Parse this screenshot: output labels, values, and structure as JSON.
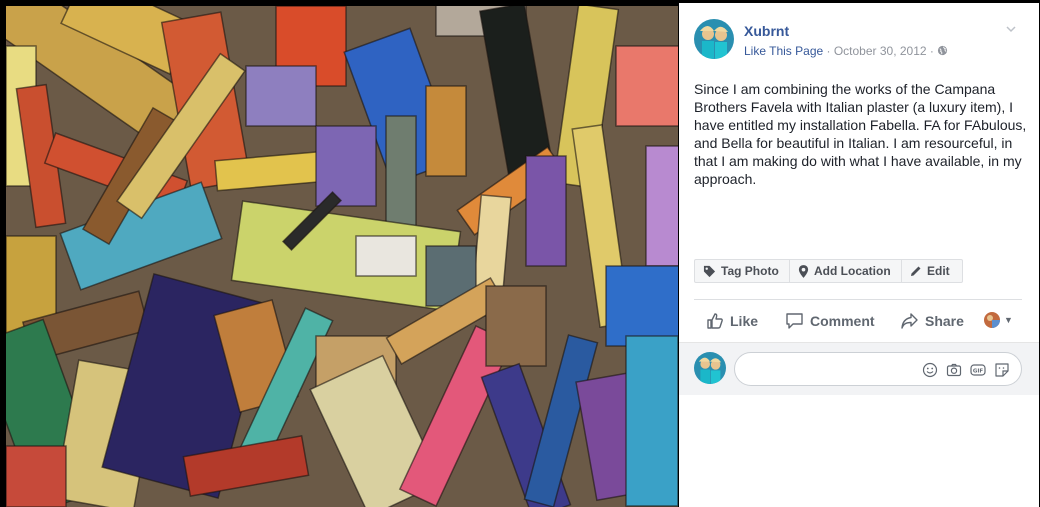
{
  "post": {
    "page_name": "Xubrnt",
    "like_page_link": "Like This Page",
    "date": "October 30, 2012",
    "separator": " · ",
    "caption": "Since I am combining the works of the Campana Brothers Favela with Italian plaster (a luxury item), I have entitled my installation Fabella. FA for FAbulous, and Bella for beautiful in Italian. I am resourceful, in that I am making do with what I have available, in my approach."
  },
  "photo_actions": {
    "tag_photo": "Tag Photo",
    "add_location": "Add Location",
    "edit": "Edit"
  },
  "actions": {
    "like": "Like",
    "comment": "Comment",
    "share": "Share"
  },
  "comment_input": {
    "placeholder": ""
  },
  "icons": {
    "privacy": "globe-icon",
    "options": "chevron-down-icon",
    "tag": "tag-icon",
    "location": "location-pin-icon",
    "edit": "pencil-icon",
    "like": "thumbs-up-icon",
    "comment": "speech-bubble-icon",
    "share": "share-arrow-icon",
    "emoji": "smiley-icon",
    "camera": "camera-icon",
    "gif": "gif-icon",
    "sticker": "sticker-icon"
  },
  "colors": {
    "link": "#365899",
    "meta": "#90949c",
    "text": "#1d2129",
    "action": "#606770"
  }
}
